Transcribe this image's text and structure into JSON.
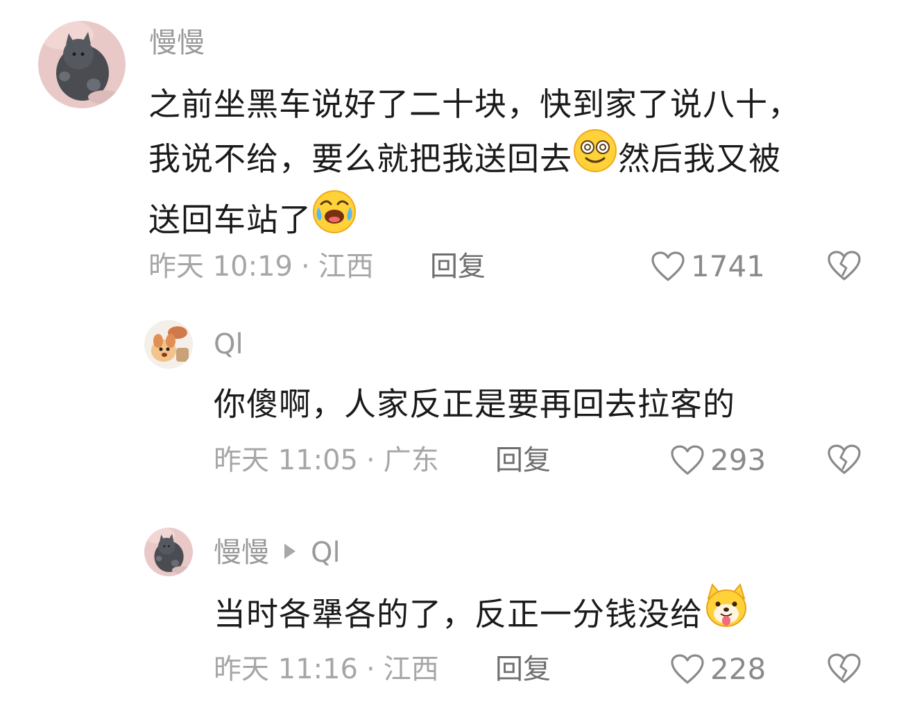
{
  "comments": [
    {
      "username": "慢慢",
      "lines": [
        "之前坐黑车说好了二十块，快到家了说八十，",
        "我说不给，要么就把我送回去",
        "然后我又被",
        "送回车站了"
      ],
      "time": "昨天 10:19",
      "location": "江西",
      "reply_label": "回复",
      "likes": "1741",
      "avatar_icon": "cat-avatar-icon"
    },
    {
      "username": "Ql",
      "text": "你傻啊，人家反正是要再回去拉客的",
      "time": "昨天 11:05",
      "location": "广东",
      "reply_label": "回复",
      "likes": "293",
      "avatar_icon": "cartoon-dog-avatar-icon"
    },
    {
      "username": "慢慢",
      "reply_to": "Ql",
      "text": "当时各犟各的了，反正一分钱没给",
      "time": "昨天 11:16",
      "location": "江西",
      "reply_label": "回复",
      "likes": "228",
      "avatar_icon": "cat-avatar-icon"
    }
  ],
  "colors": {
    "text": "#1a1a1a",
    "meta": "#a6a6a6",
    "username": "#9a9a9a",
    "reply": "#6e6e6e"
  },
  "icons": {
    "like": "heart-outline-icon",
    "dislike": "broken-heart-icon",
    "emoji_1": "dizzy-eyes-emoji-icon",
    "emoji_2": "crying-laughing-emoji-icon",
    "emoji_3": "shiba-tongue-emoji-icon"
  }
}
